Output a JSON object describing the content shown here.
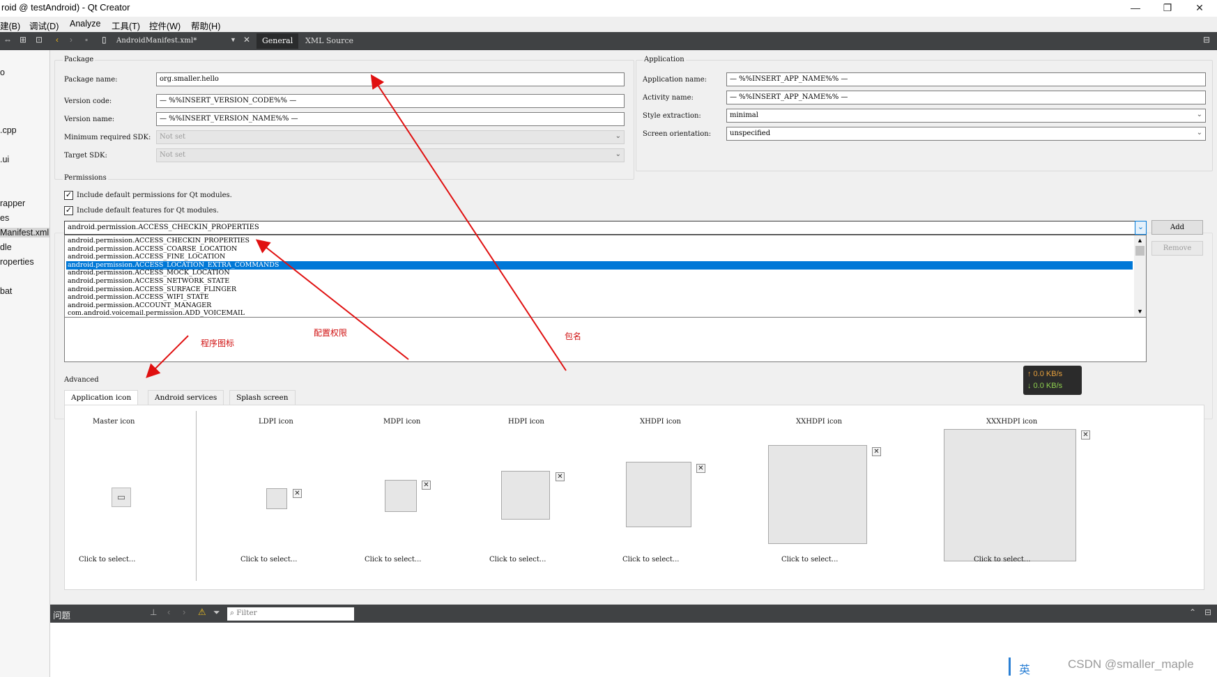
{
  "window": {
    "title": "roid @ testAndroid) - Qt Creator",
    "controls": [
      "—",
      "❐",
      "✕"
    ]
  },
  "menu": [
    "建(B)",
    "调试(D)",
    "Analyze",
    "工具(T)",
    "控件(W)",
    "帮助(H)"
  ],
  "toolbar": {
    "file_name": "AndroidManifest.xml*",
    "tabs": [
      "General",
      "XML Source"
    ]
  },
  "sidebar": {
    "items": [
      "o",
      ".cpp",
      ".ui",
      "rapper",
      "es",
      "Manifest.xml",
      "dle",
      "roperties",
      "bat"
    ]
  },
  "package": {
    "legend": "Package",
    "name_label": "Package name:",
    "name_value": "org.smaller.hello",
    "version_code_label": "Version code:",
    "version_code_value": "— %%INSERT_VERSION_CODE%% —",
    "version_name_label": "Version name:",
    "version_name_value": "— %%INSERT_VERSION_NAME%% —",
    "min_sdk_label": "Minimum required SDK:",
    "min_sdk_value": "Not set",
    "target_sdk_label": "Target SDK:",
    "target_sdk_value": "Not set"
  },
  "application": {
    "legend": "Application",
    "app_name_label": "Application name:",
    "app_name_value": "— %%INSERT_APP_NAME%% —",
    "activity_name_label": "Activity name:",
    "activity_name_value": "— %%INSERT_APP_NAME%% —",
    "style_label": "Style extraction:",
    "style_value": "minimal",
    "orientation_label": "Screen orientation:",
    "orientation_value": "unspecified"
  },
  "permissions": {
    "legend": "Permissions",
    "check_default_permissions": "Include default permissions for Qt modules.",
    "check_default_features": "Include default features for Qt modules.",
    "combo_value": "android.permission.ACCESS_CHECKIN_PROPERTIES",
    "add_label": "Add",
    "remove_label": "Remove",
    "list": [
      "android.permission.ACCESS_CHECKIN_PROPERTIES",
      "android.permission.ACCESS_COARSE_LOCATION",
      "android.permission.ACCESS_FINE_LOCATION",
      "android.permission.ACCESS_LOCATION_EXTRA_COMMANDS",
      "android.permission.ACCESS_MOCK_LOCATION",
      "android.permission.ACCESS_NETWORK_STATE",
      "android.permission.ACCESS_SURFACE_FLINGER",
      "android.permission.ACCESS_WIFI_STATE",
      "android.permission.ACCOUNT_MANAGER",
      "com.android.voicemail.permission.ADD_VOICEMAIL"
    ],
    "selected_index": 3
  },
  "advanced": {
    "legend": "Advanced",
    "tabs": [
      "Application icon",
      "Android services",
      "Splash screen"
    ],
    "icons": [
      {
        "label": "Master icon",
        "action": "Click to select..."
      },
      {
        "label": "LDPI icon",
        "action": "Click to select..."
      },
      {
        "label": "MDPI icon",
        "action": "Click to select..."
      },
      {
        "label": "HDPI icon",
        "action": "Click to select..."
      },
      {
        "label": "XHDPI icon",
        "action": "Click to select..."
      },
      {
        "label": "XXHDPI icon",
        "action": "Click to select..."
      },
      {
        "label": "XXXHDPI icon",
        "action": "Click to select..."
      }
    ]
  },
  "annotations": {
    "icon_note": "程序图标",
    "permission_note": "配置权限",
    "package_note": "包名",
    "color": "#d01010"
  },
  "issues": {
    "title": "问题",
    "filter_placeholder": "Filter"
  },
  "netspeed": {
    "up": "↑ 0.0 KB/s",
    "down": "↓ 0.0 KB/s",
    "up_color": "#e8a13c",
    "down_color": "#8fd14f"
  },
  "ime": "英",
  "watermark": "CSDN @smaller_maple"
}
